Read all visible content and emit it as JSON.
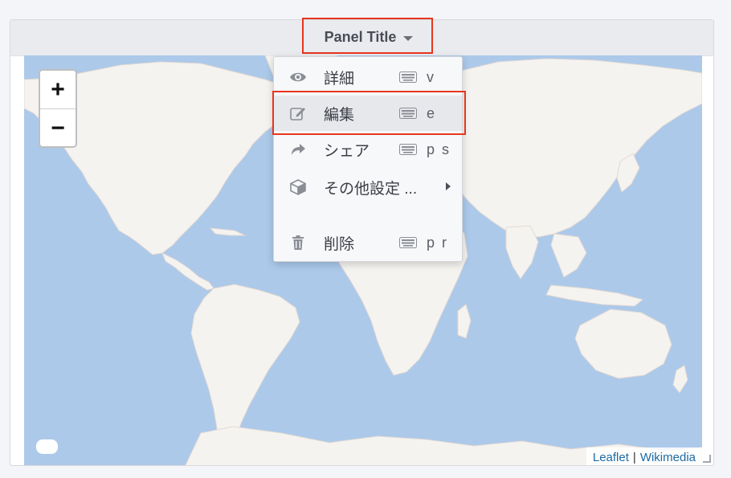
{
  "panel": {
    "title": "Panel Title",
    "title_icon": "chevron-down-icon"
  },
  "map": {
    "zoom_in_label": "+",
    "zoom_out_label": "−",
    "attribution": {
      "leaflet": "Leaflet",
      "separator": "|",
      "wikimedia": "Wikimedia"
    },
    "colors": {
      "water": "#acc9ea",
      "land": "#f5f3f0"
    }
  },
  "menu": {
    "items": [
      {
        "icon": "eye-icon",
        "label": "詳細",
        "shortcut": "v"
      },
      {
        "icon": "edit-icon",
        "label": "編集",
        "shortcut": "e",
        "active": true
      },
      {
        "icon": "share-icon",
        "label": "シェア",
        "shortcut": "p s"
      },
      {
        "icon": "cube-icon",
        "label": "その他設定 ...",
        "submenu": true
      },
      {
        "icon": "trash-icon",
        "label": "削除",
        "shortcut": "p r"
      }
    ],
    "shortcut_icon": "keyboard-icon"
  },
  "highlight_color": "#e8351e"
}
